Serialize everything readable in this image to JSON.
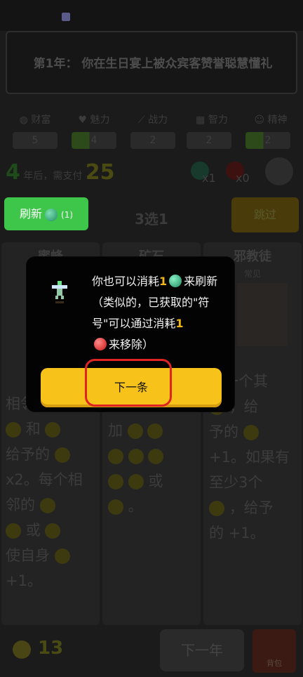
{
  "banner": {
    "text": "第1年：  你在生日宴上被众宾客赞誉聪慧懂礼"
  },
  "stats": [
    {
      "label": "财富",
      "icon": "money-bag-icon",
      "value": "5"
    },
    {
      "label": "魅力",
      "icon": "heart-icon",
      "value": "4"
    },
    {
      "label": "战力",
      "icon": "sword-icon",
      "value": "2"
    },
    {
      "label": "智力",
      "icon": "brain-icon",
      "value": "2"
    },
    {
      "label": "精神",
      "icon": "masks-icon",
      "value": "2"
    }
  ],
  "payment": {
    "years": "4",
    "label": "年后，需支付",
    "amount": "25"
  },
  "orbs": {
    "green_count": "x1",
    "red_count": "x0"
  },
  "buttons": {
    "refresh": "刷新",
    "refresh_count": "(1)",
    "skip": "跳过",
    "pick": "3选1",
    "next_year": "下一年",
    "bag": "背包"
  },
  "cards": [
    {
      "title": "蜜蜂",
      "sub": "",
      "text_lines": [
        "相邻",
        "和",
        "给予的",
        "x2。每个相",
        "邻的",
        "或",
        "使自身",
        "+1。"
      ]
    },
    {
      "title": "矿石",
      "sub": "",
      "text_lines": [
        "加"
      ]
    },
    {
      "title": "邪教徒",
      "sub": "常见",
      "text_lines": [
        "有一个其",
        "，给",
        "予的",
        "+1。如果有",
        "至少3个",
        "，给予",
        "的 +1。"
      ]
    }
  ],
  "bottom": {
    "coins": "13"
  },
  "dialog": {
    "text_part1": "你也可以消耗",
    "num1": "1",
    "text_part2": "来刷新（类似的，已获取的\"符号\"可以通过消耗",
    "num2": "1",
    "text_part3": "来移除）",
    "next_button": "下一条"
  },
  "colors": {
    "accent_yellow": "#f7c21a",
    "refresh_green": "#3ec64a",
    "highlight_red": "#e02424"
  }
}
